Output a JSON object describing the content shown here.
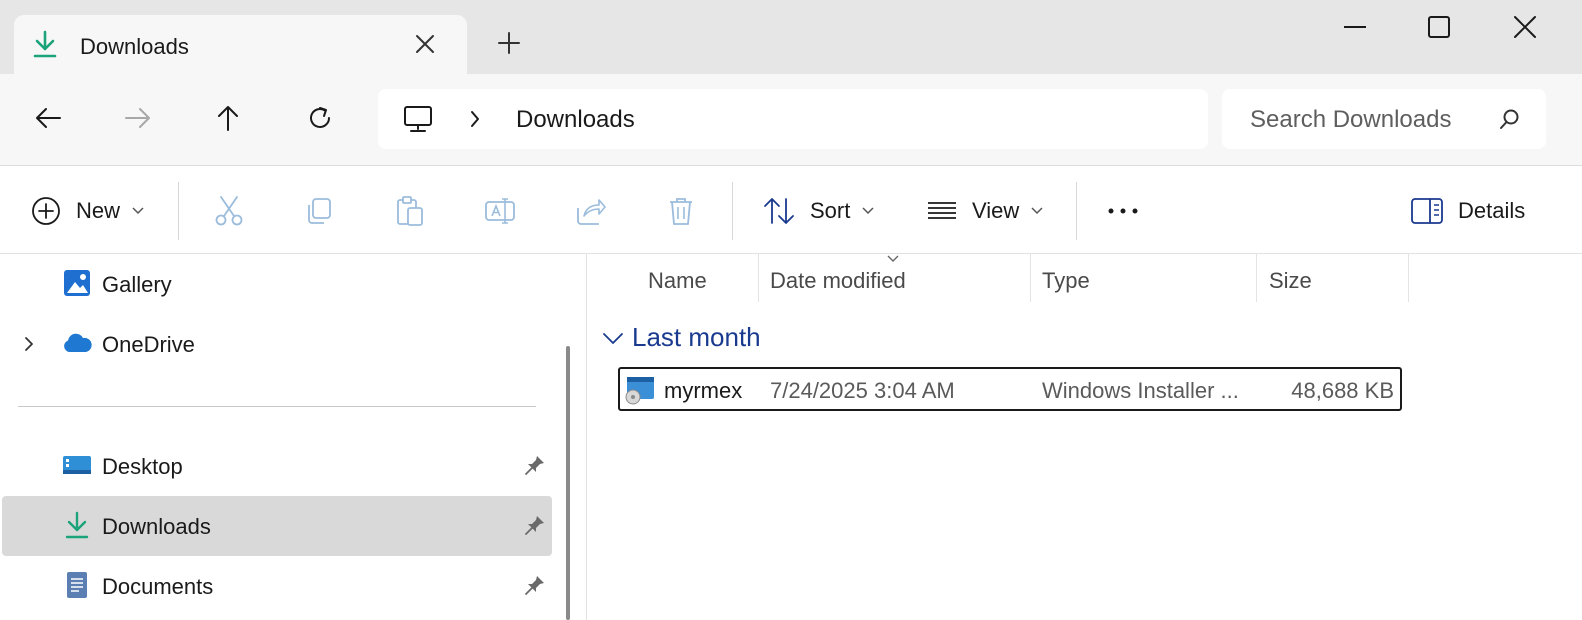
{
  "window": {
    "tab_title": "Downloads",
    "tab_icon": "download-icon",
    "controls": [
      "minimize-icon",
      "maximize-icon",
      "close-icon"
    ]
  },
  "navigation": {
    "buttons": [
      "back-icon",
      "forward-icon",
      "up-icon",
      "refresh-icon"
    ],
    "breadcrumb": [
      "This PC",
      "Downloads"
    ],
    "current": "Downloads",
    "search_placeholder": "Search Downloads"
  },
  "command_bar": {
    "new_label": "New",
    "sort_label": "Sort",
    "view_label": "View",
    "details_label": "Details",
    "actions": [
      "cut-icon",
      "copy-icon",
      "paste-icon",
      "rename-icon",
      "share-icon",
      "delete-icon"
    ]
  },
  "sidebar": {
    "items": [
      {
        "label": "Gallery",
        "icon": "gallery-icon",
        "pinned": false
      },
      {
        "label": "OneDrive",
        "icon": "onedrive-icon",
        "pinned": false,
        "expandable": true
      },
      {
        "label": "Desktop",
        "icon": "desktop-icon",
        "pinned": true
      },
      {
        "label": "Downloads",
        "icon": "download-icon",
        "pinned": true,
        "selected": true
      },
      {
        "label": "Documents",
        "icon": "documents-icon",
        "pinned": true
      }
    ]
  },
  "file_list": {
    "columns": [
      "Name",
      "Date modified",
      "Type",
      "Size"
    ],
    "sorted_by": "Date modified",
    "groups": [
      {
        "label": "Last month",
        "files": [
          {
            "name": "myrmex",
            "date": "7/24/2025 3:04 AM",
            "type": "Windows Installer ...",
            "size": "48,688 KB",
            "icon": "installer-icon",
            "selected": true
          }
        ]
      }
    ]
  },
  "colors": {
    "accent": "#1a3a8f",
    "download_green": "#1ba37a",
    "selection_bg": "#d9d9d9"
  }
}
